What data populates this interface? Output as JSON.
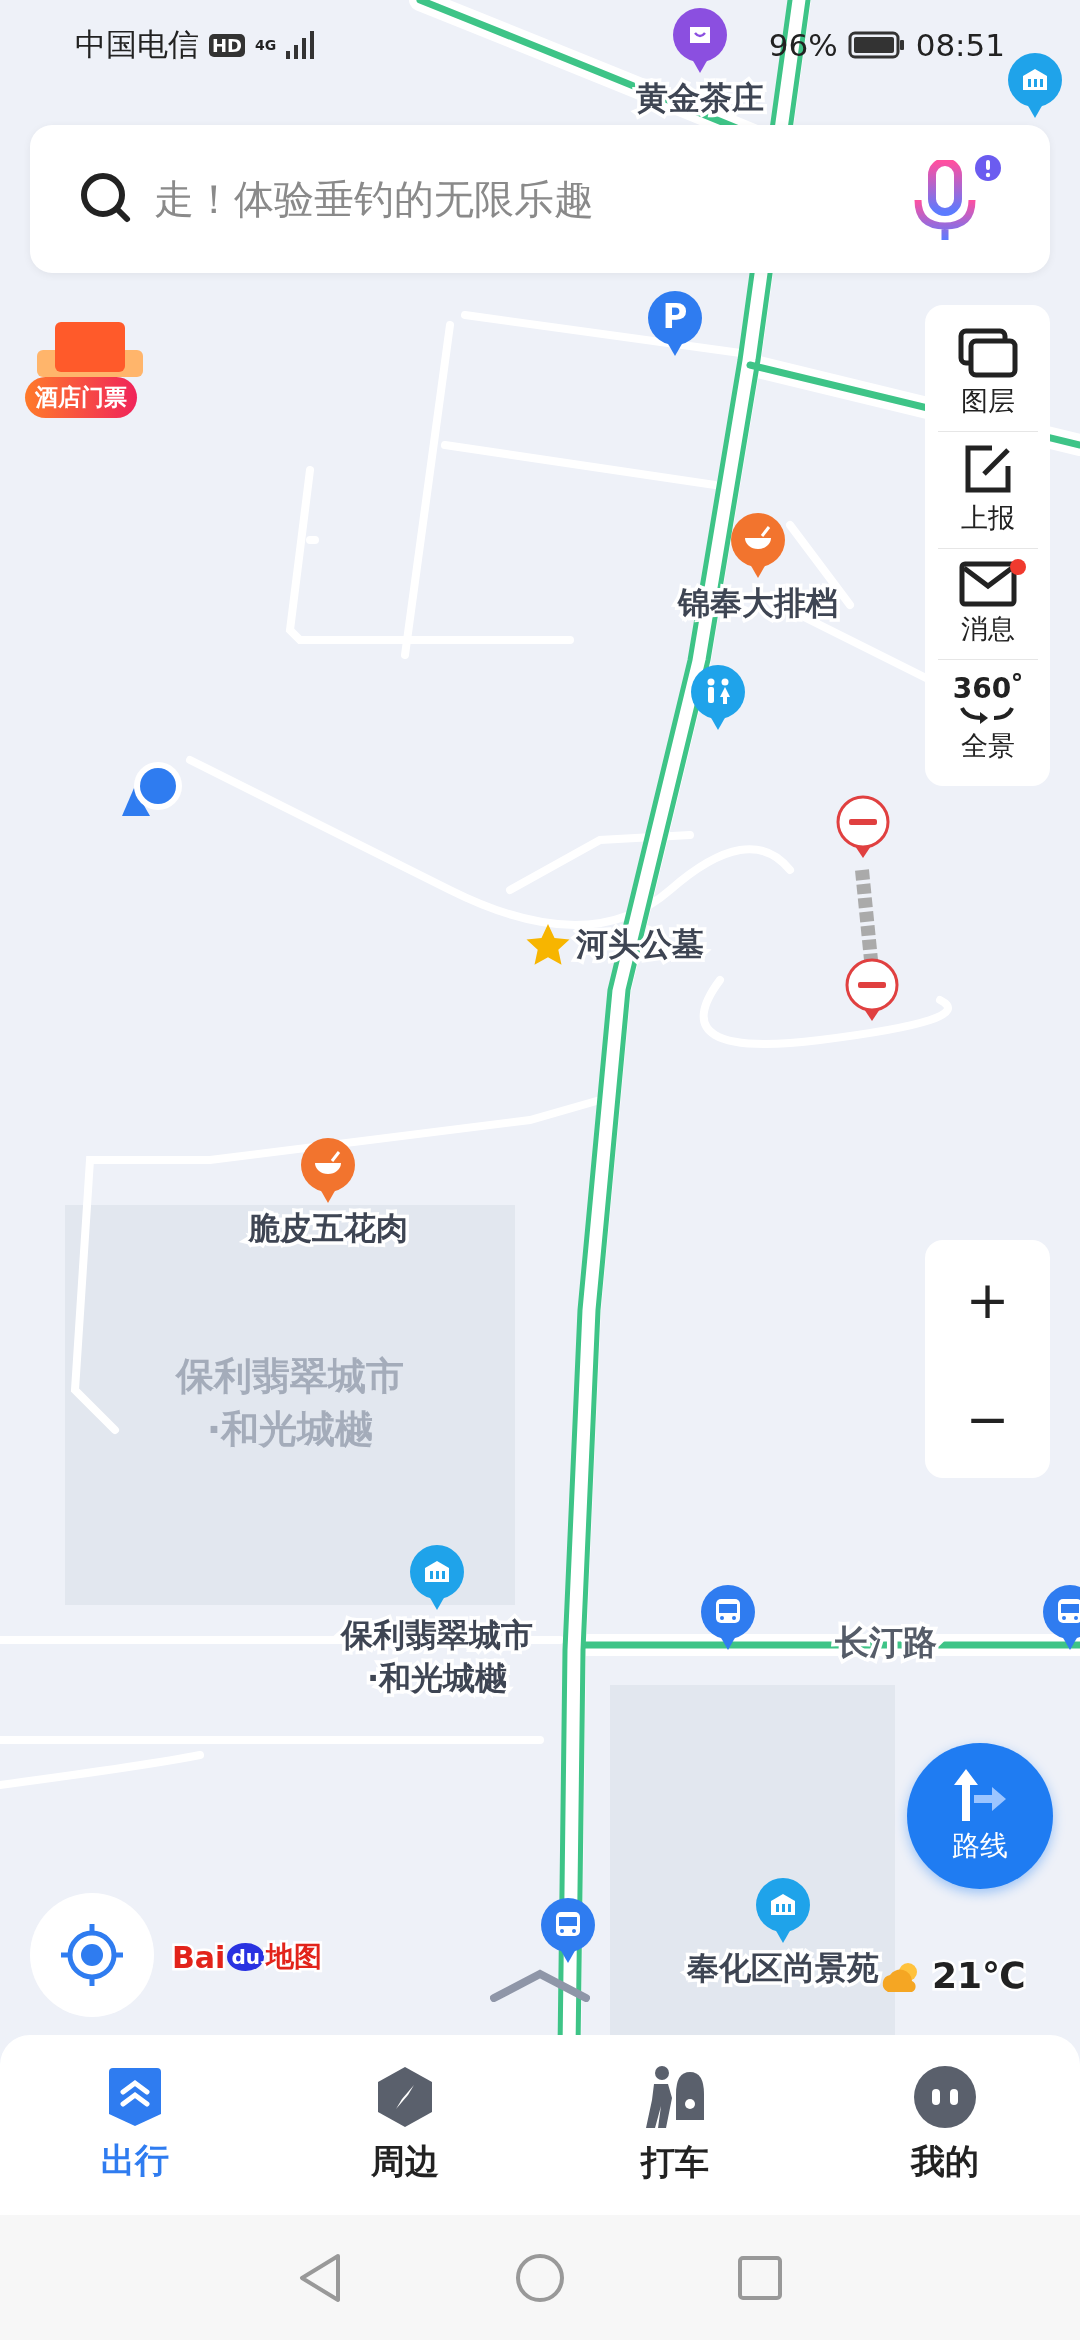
{
  "status_bar": {
    "carrier": "中国电信",
    "hd": "HD",
    "network": "4G",
    "battery": "96%",
    "time": "08:51"
  },
  "search": {
    "placeholder": "走！体验垂钓的无限乐趣",
    "voice_badge": true
  },
  "promo_badge": "酒店门票",
  "tools": [
    {
      "label": "图层",
      "kind": "layers",
      "unread": false
    },
    {
      "label": "上报",
      "kind": "report",
      "unread": false
    },
    {
      "label": "消息",
      "kind": "messages",
      "unread": true
    },
    {
      "label": "全景",
      "kind": "panorama",
      "icon_text": "360",
      "unread": false
    }
  ],
  "map": {
    "pois": [
      {
        "kind": "shop",
        "lines": [
          "黄金茶庄"
        ]
      },
      {
        "kind": "building"
      },
      {
        "kind": "parking",
        "glyph": "P"
      },
      {
        "kind": "restaurant",
        "lines": [
          "锦奉大排档"
        ]
      },
      {
        "kind": "toilet"
      },
      {
        "kind": "no_entry"
      },
      {
        "kind": "star",
        "lines": [
          "河头公墓"
        ]
      },
      {
        "kind": "no_entry"
      },
      {
        "kind": "restaurant",
        "lines": [
          "脆皮五花肉"
        ]
      },
      {
        "kind": "building",
        "lines": [
          "保利翡翠城市",
          "·和光城樾"
        ]
      },
      {
        "kind": "bus"
      },
      {
        "kind": "bus"
      },
      {
        "kind": "bus"
      },
      {
        "kind": "building",
        "lines": [
          "奉化区尚景苑"
        ]
      }
    ],
    "area_label": [
      "保利翡翠城市",
      "·和光城樾"
    ],
    "road_label": "长汀路"
  },
  "zoom": {
    "zoom_in": "+",
    "zoom_out": "−"
  },
  "route_button": "路线",
  "logo": {
    "part_1": "Bai",
    "part_2": "du",
    "part_3": "地图"
  },
  "weather": "21℃",
  "tabs": [
    {
      "label": "出行",
      "kind": "travel",
      "selected": true
    },
    {
      "label": "周边",
      "kind": "nearby",
      "selected": false
    },
    {
      "label": "打车",
      "kind": "taxi",
      "selected": false
    },
    {
      "label": "我的",
      "kind": "mine",
      "selected": false
    }
  ]
}
